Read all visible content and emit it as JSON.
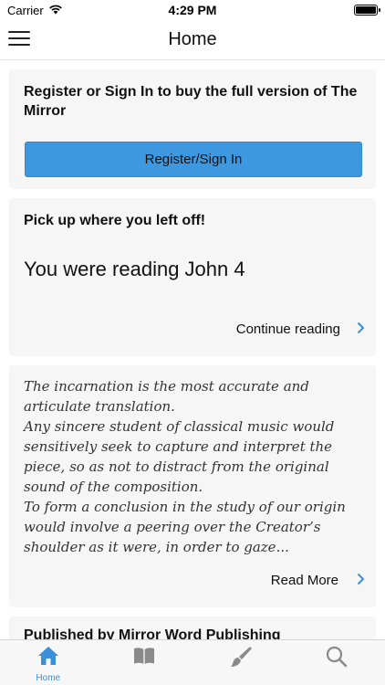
{
  "status_bar": {
    "carrier": "Carrier",
    "time": "4:29 PM"
  },
  "nav": {
    "title": "Home",
    "menu_icon": "hamburger-menu-icon"
  },
  "register_card": {
    "title": "Register or Sign In to buy the full version of The Mirror",
    "button_label": "Register/Sign In"
  },
  "progress_card": {
    "title": "Pick up where you left off!",
    "reading_text": "You were reading John 4",
    "continue_label": "Continue reading"
  },
  "quote_card": {
    "text": "The incarnation is the most accurate and articulate translation.\nAny sincere student of classical music would sensitively seek to capture and interpret the piece, so as not to distract from the original sound of the composition.\nTo form a conclusion in the study of our origin would involve a peering over the Creator’s shoulder as it were, in order to gaze...",
    "read_more_label": "Read More"
  },
  "published_card": {
    "title": "Published by Mirror Word Publishing"
  },
  "tab_bar": {
    "tabs": [
      {
        "icon": "home-icon",
        "label": "Home",
        "active": true
      },
      {
        "icon": "book-icon",
        "label": "",
        "active": false
      },
      {
        "icon": "paintbrush-icon",
        "label": "",
        "active": false
      },
      {
        "icon": "search-icon",
        "label": "",
        "active": false
      }
    ]
  },
  "colors": {
    "accent": "#3a8fd8",
    "button": "#3d98e0",
    "card_bg": "#f6f6f6",
    "inactive_icon": "#8a8a8a"
  }
}
